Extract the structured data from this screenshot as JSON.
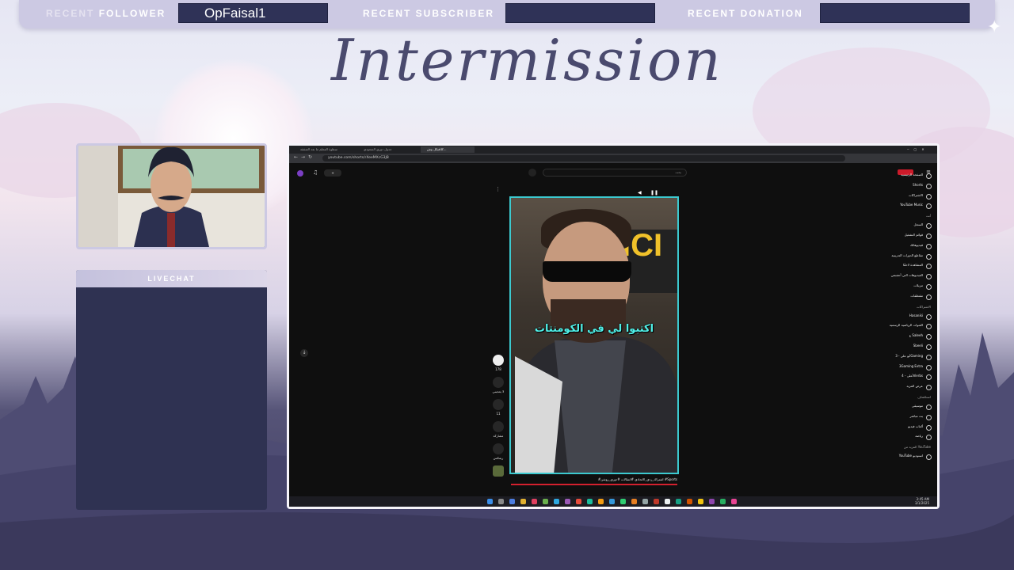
{
  "overlay": {
    "recent_follower_prefix": "RECENT",
    "recent_follower_suffix": "FOLLOWER",
    "recent_follower_value": "OpFaisal1",
    "recent_subscriber_label": "RECENT SUBSCRIBER",
    "recent_subscriber_value": "",
    "recent_donation_label": "RECENT DONATION",
    "recent_donation_value": "",
    "title": "Intermission",
    "livechat_label": "LIVECHAT"
  },
  "browser": {
    "url": "youtube.com/shorts/rXeeMXcG3J8",
    "tabs": [
      {
        "label": "سطوة المعلم ما بعد الصفقة"
      },
      {
        "label": "جدول دوري السعودي"
      },
      {
        "label": "كلافيكل وش..."
      }
    ]
  },
  "youtube": {
    "search_label": "بحث",
    "caption": "اكتبوا لي في الكومنتات",
    "like_count": "178",
    "dislike_label": "لا يعجبني",
    "comment_count": "11",
    "share_label": "مشاركة",
    "remix_label": "ريمكس",
    "video_title": "#اشتراك_ردي_الاتحادي #انتقالات #دوري_روشن #Sports",
    "channel_badge": "اشتراك",
    "sidebar": {
      "main": [
        {
          "label": "الصفحة الرئيسية"
        },
        {
          "label": "Shorts"
        },
        {
          "label": "الاشتراكات"
        },
        {
          "label": "YouTube Music"
        }
      ],
      "you_header": "أنت",
      "you": [
        {
          "label": "السجل"
        },
        {
          "label": "قوائم التشغيل"
        },
        {
          "label": "فيديوهاتك"
        },
        {
          "label": "مقاطع الدورات التدريبية"
        },
        {
          "label": "المشاهدة لاحقًا"
        },
        {
          "label": "الفيديوهات التي أعجبتني"
        },
        {
          "label": "تنزيلات"
        },
        {
          "label": "مقتطفات"
        }
      ],
      "subs_header": "الاشتراكات",
      "subs": [
        {
          "label": "Hasaniki"
        },
        {
          "label": "القنوات الرياضية الرسمية"
        },
        {
          "label": "ع Saleeh"
        },
        {
          "label": "Sbeeli"
        },
        {
          "label": "أبو علي - 3Gaming"
        },
        {
          "label": "3Gaming Extra"
        },
        {
          "label": "الأعلى - 4lerbs"
        },
        {
          "label": "عرض المزيد"
        }
      ],
      "explore_header": "استكشاف",
      "explore": [
        {
          "label": "موسيقى"
        },
        {
          "label": "بث مباشر"
        },
        {
          "label": "ألعاب فيديو"
        },
        {
          "label": "رياضة"
        }
      ],
      "more_header": "المزيد من YouTube",
      "more": [
        {
          "label": "YouTube استوديو"
        }
      ]
    }
  },
  "taskbar": {
    "time": "3:45 AM",
    "date": "3/1/2025"
  }
}
